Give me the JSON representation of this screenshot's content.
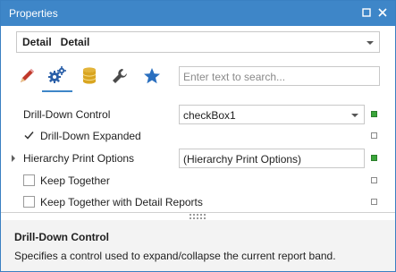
{
  "window": {
    "title": "Properties"
  },
  "colors": {
    "accent": "#3e86c8",
    "marker_green": "#3aa53a",
    "pencil_red": "#c0392b",
    "db_yellow": "#d9a520",
    "star_blue": "#2a6fbf"
  },
  "object_selector": {
    "value": "Detail   Detail"
  },
  "tabs": [
    {
      "icon": "pencil-icon",
      "active": false
    },
    {
      "icon": "gears-icon",
      "active": true
    },
    {
      "icon": "database-icon",
      "active": false
    },
    {
      "icon": "wrench-icon",
      "active": false
    },
    {
      "icon": "star-icon",
      "active": false
    }
  ],
  "search": {
    "placeholder": "Enter text to search..."
  },
  "properties": [
    {
      "label": "Drill-Down Control",
      "value": "checkBox1",
      "marker": "filled"
    },
    {
      "label": "Drill-Down Expanded",
      "checked": true,
      "marker": "empty"
    },
    {
      "label": "Hierarchy Print Options",
      "value": "(Hierarchy Print Options)",
      "marker": "filled"
    },
    {
      "label": "Keep Together",
      "checked": false,
      "marker": "empty"
    },
    {
      "label": "Keep Together with Detail Reports",
      "checked": false,
      "marker": "empty"
    }
  ],
  "description": {
    "title": "Drill-Down Control",
    "text": "Specifies a control used to expand/collapse the current report band."
  }
}
